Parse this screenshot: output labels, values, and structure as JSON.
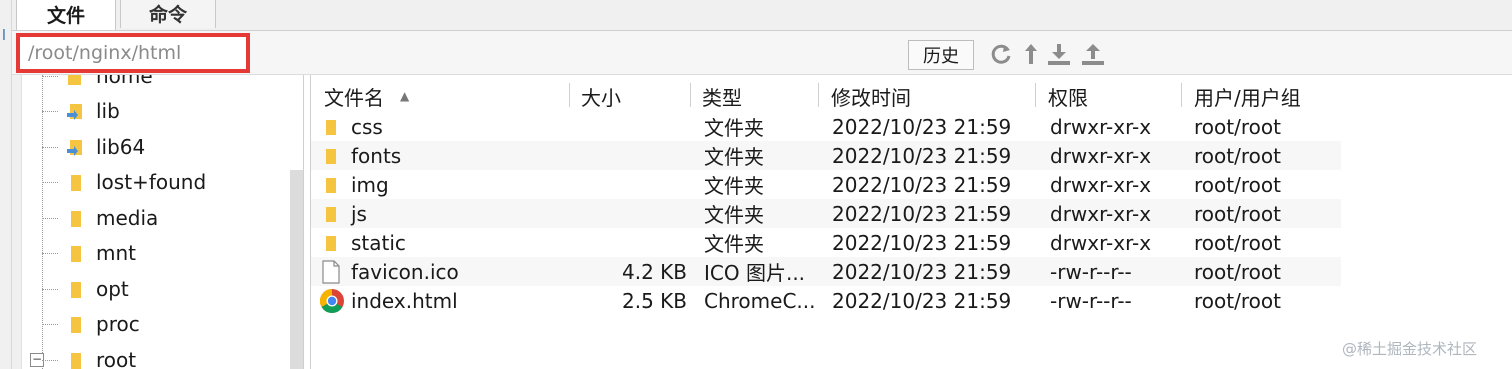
{
  "tabs": [
    {
      "label": "文件"
    },
    {
      "label": "命令"
    }
  ],
  "left_edge_glyph": "l",
  "toolbar": {
    "path_value": "/root/nginx/html",
    "history_label": "历史",
    "icons": [
      "refresh-icon",
      "up-directory-icon",
      "download-icon",
      "upload-icon"
    ]
  },
  "tree": {
    "partial_top_label": "home",
    "items": [
      {
        "label": "lib",
        "icon": "folder-link-icon"
      },
      {
        "label": "lib64",
        "icon": "folder-link-icon"
      },
      {
        "label": "lost+found",
        "icon": "folder-icon"
      },
      {
        "label": "media",
        "icon": "folder-icon"
      },
      {
        "label": "mnt",
        "icon": "folder-icon"
      },
      {
        "label": "opt",
        "icon": "folder-icon"
      },
      {
        "label": "proc",
        "icon": "folder-icon"
      },
      {
        "label": "root",
        "icon": "folder-icon"
      }
    ],
    "root_expander": "−"
  },
  "columns": {
    "name": "文件名",
    "sort_arrow": "▲",
    "size": "大小",
    "type": "类型",
    "modified": "修改时间",
    "permissions": "权限",
    "owner": "用户/用户组"
  },
  "files": [
    {
      "name": "css",
      "icon": "folder-icon",
      "size": "",
      "type": "文件夹",
      "modified": "2022/10/23 21:59",
      "permissions": "drwxr-xr-x",
      "owner": "root/root"
    },
    {
      "name": "fonts",
      "icon": "folder-icon",
      "size": "",
      "type": "文件夹",
      "modified": "2022/10/23 21:59",
      "permissions": "drwxr-xr-x",
      "owner": "root/root"
    },
    {
      "name": "img",
      "icon": "folder-icon",
      "size": "",
      "type": "文件夹",
      "modified": "2022/10/23 21:59",
      "permissions": "drwxr-xr-x",
      "owner": "root/root"
    },
    {
      "name": "js",
      "icon": "folder-icon",
      "size": "",
      "type": "文件夹",
      "modified": "2022/10/23 21:59",
      "permissions": "drwxr-xr-x",
      "owner": "root/root"
    },
    {
      "name": "static",
      "icon": "folder-icon",
      "size": "",
      "type": "文件夹",
      "modified": "2022/10/23 21:59",
      "permissions": "drwxr-xr-x",
      "owner": "root/root"
    },
    {
      "name": "favicon.ico",
      "icon": "file-icon",
      "size": "4.2 KB",
      "type": "ICO 图片...",
      "modified": "2022/10/23 21:59",
      "permissions": "-rw-r--r--",
      "owner": "root/root"
    },
    {
      "name": "index.html",
      "icon": "chrome-icon",
      "size": "2.5 KB",
      "type": "ChromeC...",
      "modified": "2022/10/23 21:59",
      "permissions": "-rw-r--r--",
      "owner": "root/root"
    }
  ],
  "watermark": "@稀土掘金技术社区",
  "colors": {
    "highlight_border": "#e53935",
    "folder": "#f5c542",
    "path_text": "#8a8a8a"
  }
}
